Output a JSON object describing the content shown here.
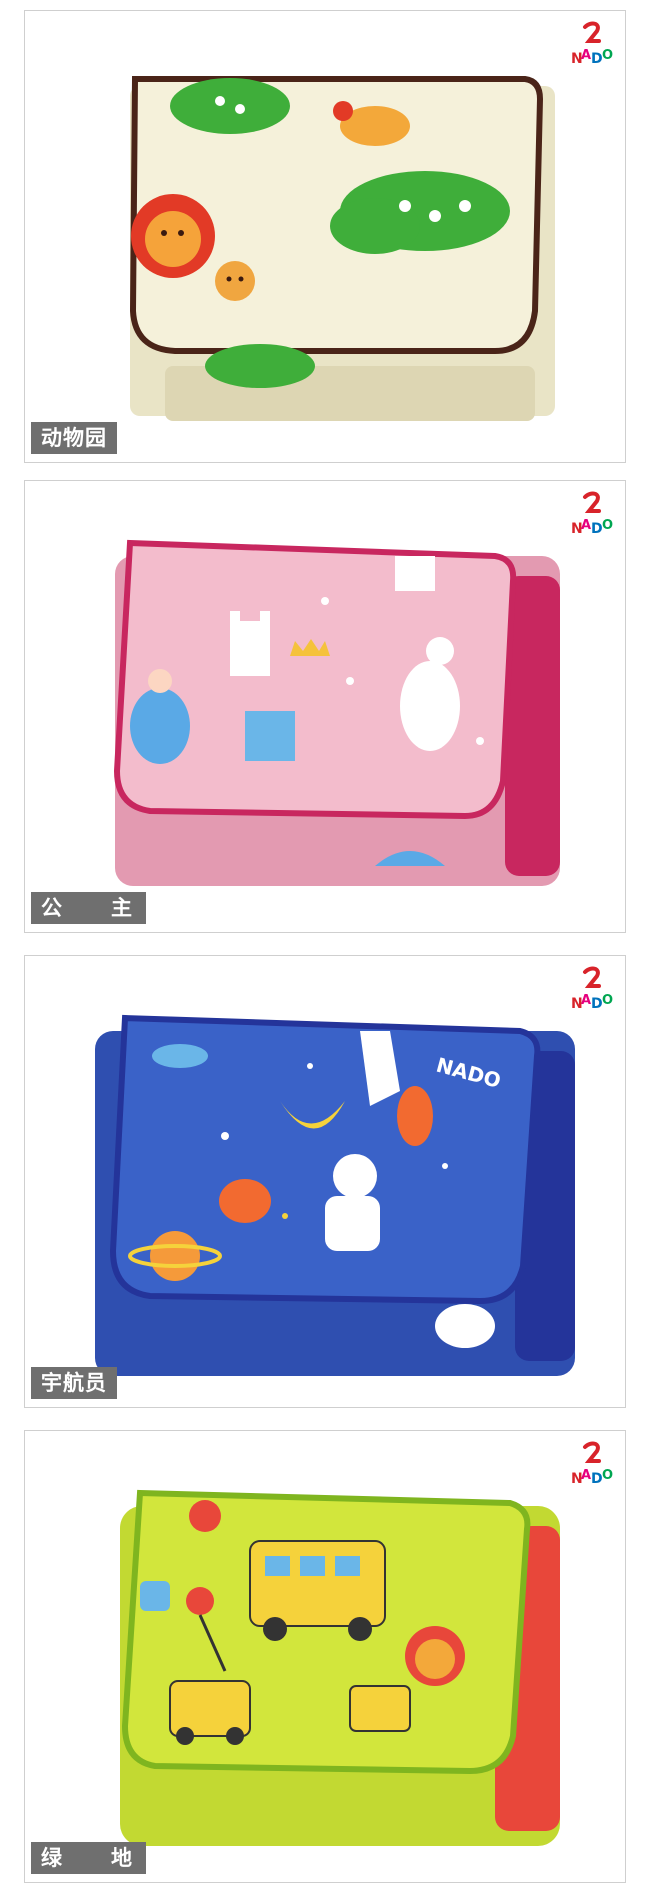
{
  "brand": {
    "logo_text": "NADO"
  },
  "products": [
    {
      "label": "动物园",
      "theme": "zoo",
      "colors": {
        "base": "#f4f0d8",
        "trim": "#4a2418",
        "accent": "#3fae3a"
      }
    },
    {
      "label": "公　主",
      "theme": "princess",
      "colors": {
        "base": "#f2b7c8",
        "trim": "#c8275f",
        "accent": "#5aa9e6"
      }
    },
    {
      "label": "宇航员",
      "theme": "astronaut",
      "colors": {
        "base": "#3a5fc2",
        "trim": "#24349a",
        "accent": "#f5d23b"
      }
    },
    {
      "label": "绿　地",
      "theme": "green",
      "colors": {
        "base": "#cfe339",
        "trim": "#7fb51f",
        "accent": "#e8473a"
      }
    }
  ]
}
